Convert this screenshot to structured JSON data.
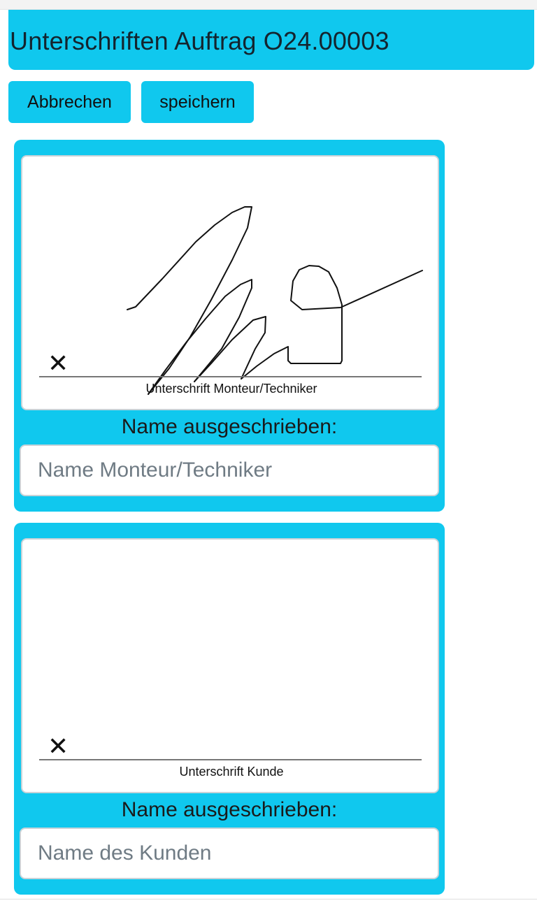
{
  "header": {
    "title": "Unterschriften Auftrag O24.00003"
  },
  "toolbar": {
    "cancel_label": "Abbrechen",
    "save_label": "speichern"
  },
  "signature_technician": {
    "x_mark": "✕",
    "caption": "Unterschrift Monteur/Techniker",
    "name_label": "Name ausgeschrieben:",
    "name_value": "",
    "name_placeholder": "Name Monteur/Techniker",
    "signed": true
  },
  "signature_customer": {
    "x_mark": "✕",
    "caption": "Unterschrift Kunde",
    "name_label": "Name ausgeschrieben:",
    "name_value": "",
    "name_placeholder": "Name des Kunden",
    "signed": false
  },
  "colors": {
    "accent": "#10c8ee",
    "title_text": "#14242e"
  }
}
